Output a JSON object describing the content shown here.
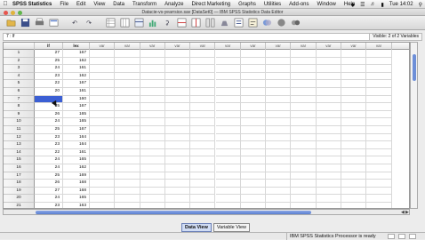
{
  "menubar": {
    "apple": "",
    "app": "SPSS Statistics",
    "items": [
      "File",
      "Edit",
      "View",
      "Data",
      "Transform",
      "Analyze",
      "Direct Marketing",
      "Graphs",
      "Utilities",
      "Add-ons",
      "Window",
      "Help"
    ],
    "clock": "Tue 14:02"
  },
  "window": {
    "title": "Datacie-vs-yearrsice.sav [DataSet0] — IBM SPSS Statistics Data Editor"
  },
  "cellbar": {
    "ref": "7 : lf",
    "visible": "Visible: 2 of 2 Variables"
  },
  "grid": {
    "variables": [
      "lf",
      "lex"
    ],
    "empty_header": "var",
    "rows": [
      {
        "n": "1",
        "lf": "27",
        "lex": "167"
      },
      {
        "n": "2",
        "lf": "25",
        "lex": "162"
      },
      {
        "n": "3",
        "lf": "24",
        "lex": "161"
      },
      {
        "n": "4",
        "lf": "23",
        "lex": "162"
      },
      {
        "n": "5",
        "lf": "22",
        "lex": "167"
      },
      {
        "n": "6",
        "lf": "20",
        "lex": "161"
      },
      {
        "n": "7",
        "lf": "",
        "lex": "160"
      },
      {
        "n": "8",
        "lf": "25",
        "lex": "167"
      },
      {
        "n": "9",
        "lf": "26",
        "lex": "165"
      },
      {
        "n": "10",
        "lf": "24",
        "lex": "165"
      },
      {
        "n": "11",
        "lf": "25",
        "lex": "167"
      },
      {
        "n": "12",
        "lf": "23",
        "lex": "164"
      },
      {
        "n": "13",
        "lf": "23",
        "lex": "164"
      },
      {
        "n": "14",
        "lf": "22",
        "lex": "161"
      },
      {
        "n": "15",
        "lf": "24",
        "lex": "165"
      },
      {
        "n": "16",
        "lf": "24",
        "lex": "162"
      },
      {
        "n": "17",
        "lf": "25",
        "lex": "169"
      },
      {
        "n": "18",
        "lf": "26",
        "lex": "168"
      },
      {
        "n": "19",
        "lf": "27",
        "lex": "168"
      },
      {
        "n": "20",
        "lf": "24",
        "lex": "165"
      },
      {
        "n": "21",
        "lf": "23",
        "lex": "163"
      }
    ]
  },
  "tabs": {
    "data_view": "Data View",
    "variable_view": "Variable View"
  },
  "status": {
    "message": "IBM SPSS Statistics Processor is ready"
  },
  "colors": {
    "selection": "#3b5fd4",
    "accent": "#6d8fd8"
  }
}
